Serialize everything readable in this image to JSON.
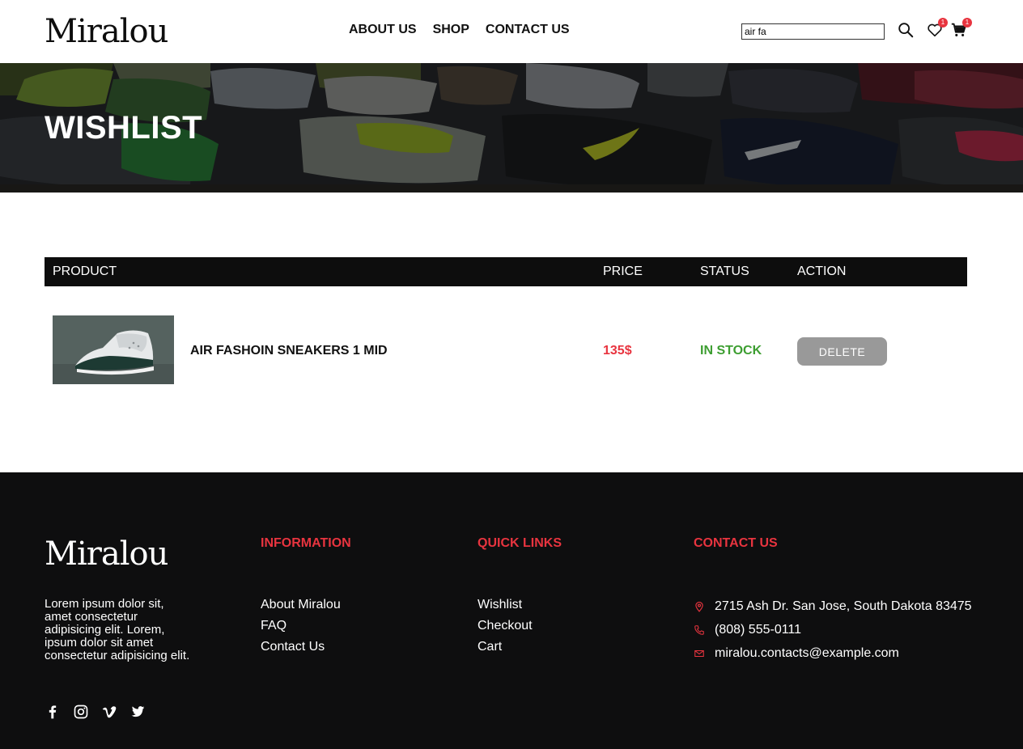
{
  "brand": {
    "logo": "Miralou"
  },
  "nav": {
    "items": [
      "ABOUT US",
      "SHOP",
      "CONTACT US"
    ]
  },
  "search": {
    "value": "air fa"
  },
  "header_icons": {
    "search": "search-icon",
    "wishlist": {
      "icon": "heart-icon",
      "count": "1"
    },
    "cart": {
      "icon": "cart-icon",
      "count": "1"
    }
  },
  "banner": {
    "title": "WISHLIST"
  },
  "table": {
    "headers": {
      "product": "PRODUCT",
      "price": "PRICE",
      "status": "STATUS",
      "action": "ACTION"
    },
    "rows": [
      {
        "name": "AIR FASHOIN SNEAKERS 1 MID",
        "price": "135$",
        "status": "IN STOCK",
        "action": "DELETE"
      }
    ]
  },
  "footer": {
    "logo": "Miralou",
    "about": "Lorem ipsum dolor sit, amet consectetur adipisicing elit. Lorem, ipsum dolor sit amet consectetur adipisicing elit.",
    "social": [
      "facebook-icon",
      "instagram-icon",
      "vimeo-icon",
      "twitter-icon"
    ],
    "information": {
      "title": "INFORMATION",
      "links": [
        "About Miralou",
        "FAQ",
        "Contact Us"
      ]
    },
    "quick_links": {
      "title": "QUICK LINKS",
      "links": [
        "Wishlist",
        "Checkout",
        "Cart"
      ]
    },
    "contact": {
      "title": "CONTACT US",
      "address": "2715 Ash Dr. San Jose, South Dakota 83475",
      "phone": "(808) 555-0111",
      "email": "miralou.contacts@example.com"
    }
  },
  "colors": {
    "accent": "#e8343f",
    "in_stock": "#3d9e31",
    "dark": "#0e0e0f",
    "button": "#999999"
  }
}
